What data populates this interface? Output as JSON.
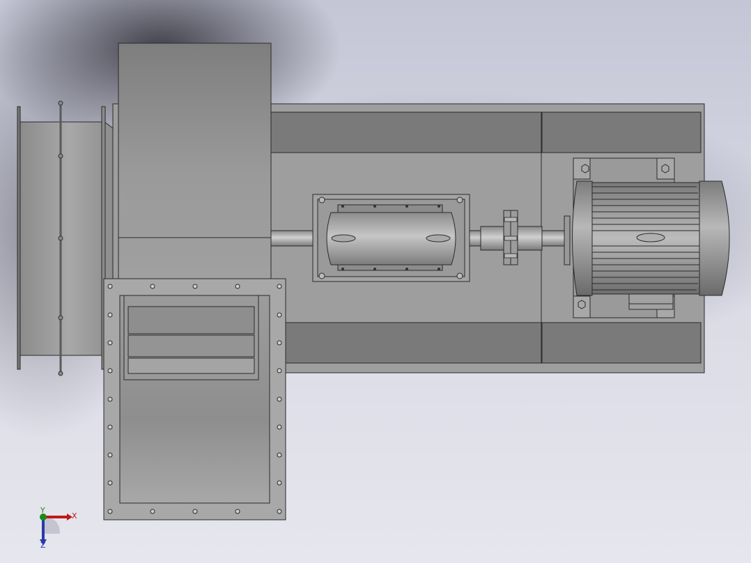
{
  "view": {
    "model": "centrifugal-fan-assembly",
    "background_top": "#c4c6d6",
    "background_bottom": "#e6e6ee",
    "metal_light": "#b4b4b4",
    "metal_mid": "#9a9a9a",
    "metal_dark": "#6e6e6e",
    "edge": "#2a2a2a"
  },
  "triad": {
    "x_label": "X",
    "y_label": "Y",
    "z_label": "Z",
    "x_color": "#c01818",
    "y_color": "#1a8a1a",
    "z_color": "#2a3aa8"
  }
}
